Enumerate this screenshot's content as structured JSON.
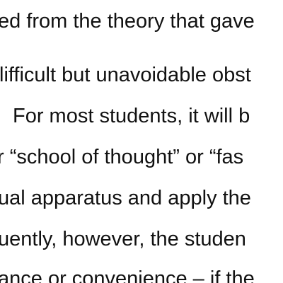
{
  "document": {
    "lines": [
      "ed from the theory that gave",
      "lifficult but unavoidable obst",
      "For most students, it will b",
      "r “school of thought” or “fas",
      "ual apparatus and apply the",
      "uently, however, the studen",
      "ance or convenience – if the"
    ]
  }
}
